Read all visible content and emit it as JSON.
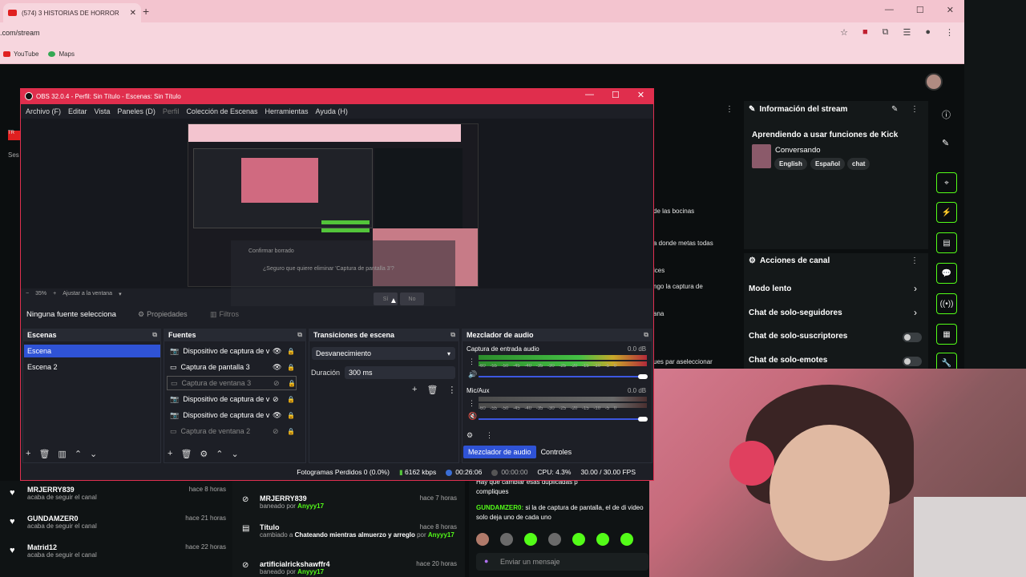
{
  "browser": {
    "tab_title": "(574) 3 HISTORIAS DE HORROR",
    "url": ".com/stream",
    "bookmarks": [
      {
        "label": "YouTube",
        "color": "#e02020"
      },
      {
        "label": "Maps",
        "color": "#34a853"
      }
    ]
  },
  "obs": {
    "window_title": "OBS 32.0.4 - Perfil: Sin Título - Escenas: Sin Título",
    "menu": [
      "Archivo (F)",
      "Editar",
      "Vista",
      "Paneles (D)",
      "Perfil",
      "Colección de Escenas",
      "Herramientas",
      "Ayuda (H)"
    ],
    "zoom": "35%",
    "fit_label": "Ajustar a la ventana",
    "no_source": "Ninguna fuente selecciona",
    "props_label": "Propiedades",
    "filters_label": "Filtros",
    "dialog": {
      "title": "Confirmar borrado",
      "text": "¿Seguro que quiere eliminar 'Captura de pantalla 3'?",
      "yes": "Sí",
      "no": "No"
    },
    "scenes": {
      "title": "Escenas",
      "items": [
        "Escena",
        "Escena 2"
      ]
    },
    "sources": {
      "title": "Fuentes",
      "items": [
        "Dispositivo de captura de v",
        "Captura de pantalla 3",
        "Captura de ventana 3",
        "Dispositivo de captura de v",
        "Dispositivo de captura de v",
        "Captura de ventana 2"
      ]
    },
    "transitions": {
      "title": "Transiciones de escena",
      "selected": "Desvanecimiento",
      "duration_label": "Duración",
      "duration_value": "300 ms"
    },
    "mixer": {
      "title": "Mezclador de audio",
      "channels": [
        {
          "name": "Captura de entrada audio",
          "db": "0.0 dB"
        },
        {
          "name": "Mic/Aux",
          "db": "0.0 dB"
        }
      ],
      "scale": "-60 -55 -50 -45 -40 -35 -30 -25 -20 -15 -10 -5 0",
      "tabs": [
        "Mezclador de audio",
        "Controles"
      ]
    },
    "status": {
      "dropped": "Fotogramas Perdidos 0 (0.0%)",
      "bitrate": "6162 kbps",
      "stream_time": "00:26:06",
      "rec_time": "00:00:00",
      "cpu": "CPU: 4.3%",
      "fps": "30.00 / 30.00 FPS"
    }
  },
  "kick": {
    "stream_info": {
      "title": "Información del stream",
      "stream_title": "Aprendiendo a usar funciones de Kick",
      "category": "Conversando",
      "tags": [
        "English",
        "Español",
        "chat"
      ]
    },
    "channel_actions": {
      "title": "Acciones de canal",
      "items": [
        "Modo lento",
        "Chat de solo-seguidores",
        "Chat de solo-suscriptores",
        "Chat de solo-emotes"
      ]
    },
    "middle_snippets": [
      "de las bocinas",
      "a donde metas todas",
      "ices",
      "ngo la captura de",
      "ana",
      "ues par aseleccionar"
    ],
    "follows": [
      {
        "name": "MRJERRY839",
        "sub": "acaba de seguir el canal",
        "time": "hace 8 horas"
      },
      {
        "name": "GUNDAMZER0",
        "sub": "acaba de seguir el canal",
        "time": "hace 21 horas"
      },
      {
        "name": "Matrid12",
        "sub": "acaba de seguir el canal",
        "time": "hace 22 horas"
      }
    ],
    "mod_log": [
      {
        "name": "MRJERRY839",
        "pre": "baneado por",
        "who": "Anyyy17",
        "time": "hace 7 horas"
      },
      {
        "name": "Título",
        "pre": "cambiado a",
        "extra": "Chateando mientras almuerzo y arreglo",
        "who": "Anyyy17",
        "time": "hace 8 horas"
      },
      {
        "name": "artificialrickshawffr4",
        "pre": "baneado por",
        "who": "Anyyy17",
        "time": "hace 20 horas"
      }
    ],
    "chat": {
      "top_line": "Hay que cambiar esas duplicadas p",
      "top_line2": "compliques",
      "msg_user": "GUNDAMZER0:",
      "msg_text": "si la de captura de pantalla, el de di video solo deja uno de cada uno",
      "input_placeholder": "Enviar un mensaje"
    },
    "accent": "#53fc18"
  }
}
